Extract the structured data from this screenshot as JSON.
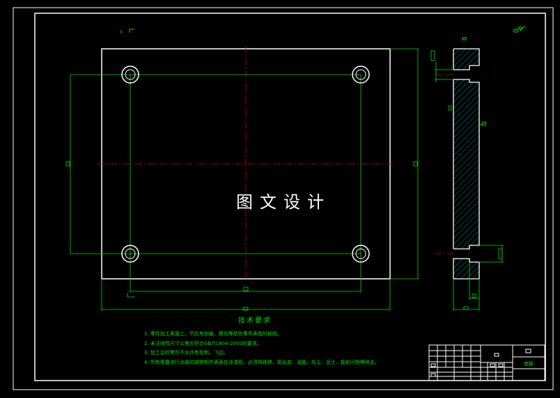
{
  "watermark": "图文设计",
  "technical_requirements": {
    "title": "技术要求",
    "items": [
      "1. 零件加工表面上，不应有划痕、擦伤等损伤零件表面的缺陷。",
      "2. 未注线性尺寸公差应符合GB/T1804-2000的要求。",
      "3. 加工后的零件不允许有毛刺、飞边。",
      "4. 所有需要进行涂装的钢铁制件表面在涂漆前，必须将铁锈、氧化皮、油脂、灰尘、泥土、盐和污物等除去。"
    ]
  },
  "title_block": {
    "material": "底板"
  },
  "colors": {
    "background": "#000000",
    "outline": "#ffffff",
    "dimension": "#00e000",
    "centerline": "#e00000",
    "hatch": "#00b0b0"
  }
}
